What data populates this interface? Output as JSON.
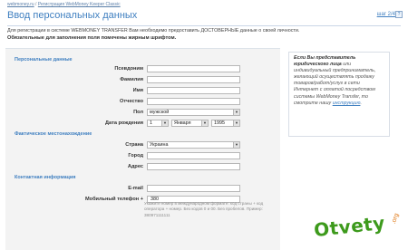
{
  "breadcrumb": {
    "home": "webmoney.ru",
    "sep": "/",
    "current": "Регистрация WebMoney Keeper Classic"
  },
  "page_title": "Ввод персональных данных",
  "step": "шаг 2/4",
  "step_icon": "help-icon",
  "intro": {
    "line1": "Для регистрации в системе WEBMONEY TRANSFER Вам необходимо предоставить ДОСТОВЕРНЫЕ данные о своей личности.",
    "line2": "Обязательные для заполнения поля помечены жирным шрифтом."
  },
  "sections": {
    "personal": "Персональные данные",
    "address": "Фактическое местонахождение",
    "contacts": "Контактная информация"
  },
  "fields": {
    "alias": {
      "label": "Псевдоним",
      "value": ""
    },
    "last_name": {
      "label": "Фамилия",
      "value": ""
    },
    "first_name": {
      "label": "Имя",
      "value": ""
    },
    "patronymic": {
      "label": "Отчество",
      "value": ""
    },
    "sex": {
      "label": "Пол",
      "value": "мужской"
    },
    "birth": {
      "label": "Дата рождения",
      "day": "1",
      "month": "Января",
      "year": "1995"
    },
    "country": {
      "label": "Страна",
      "value": "Украина"
    },
    "city": {
      "label": "Город",
      "value": ""
    },
    "addr": {
      "label": "Адрес",
      "value": ""
    },
    "email": {
      "label": "E-mail",
      "value": ""
    },
    "phone": {
      "label": "Мобильный телефон +",
      "value": "380"
    }
  },
  "phone_hint": "Укажите номер в международном формате: код страны + код оператора + номер. Без кодов 0 и 00. Без пробелов. Пример: 380971111111",
  "side_note": {
    "q": "Если Вы представитель юридического лица",
    "mid": " или индивидуальный предприниматель, желающий осуществлять продажу товаров/работ/услуг в сети Интернет с оплатой посредством системы WebMoney Transfer, то смотрите нашу ",
    "link": "инструкцию",
    "end": "."
  },
  "watermark": {
    "text": "Otvety",
    "suffix": ".org"
  },
  "colors": {
    "accent": "#3f7fc0",
    "form_bg": "#f3f3f3"
  }
}
